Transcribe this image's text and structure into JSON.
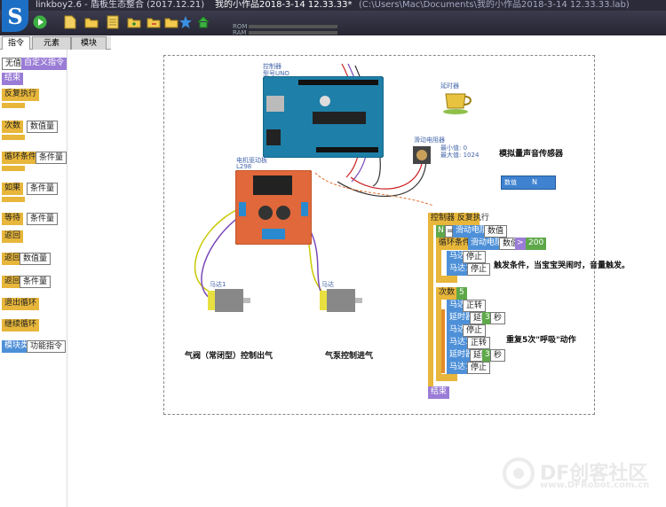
{
  "window": {
    "app_title": "linkboy2.6 - 盾板生态整合 (2017.12.21)",
    "doc_title": "我的小作品2018-3-14 12.33.33*",
    "path": "(C:\\Users\\Mac\\Documents\\我的小作品2018-3-14 12.33.33.lab)"
  },
  "toolbar": {
    "rom_label": "ROM",
    "ram_label": "RAM"
  },
  "logo_text": "S",
  "tabs": [
    "指令",
    "元素",
    "模块"
  ],
  "palette": {
    "none_value": "无值",
    "custom_cmd": "自定义指令",
    "end": "结束",
    "repeat": "反复执行",
    "times": "次数",
    "number": "数值量",
    "loop_cond": "循环条件",
    "condition": "条件量",
    "if": "如果",
    "if_cond": "条件量",
    "wait": "等待",
    "wait_cond": "条件量",
    "return1": "返回",
    "return2": "返回",
    "return2_val": "数值量",
    "return3": "返回",
    "return3_val": "条件量",
    "exit_loop": "退出循环",
    "continue_loop": "继续循环",
    "module_class": "模块类",
    "func_cmd": "功能指令"
  },
  "canvas": {
    "controller_label": "控制器",
    "controller_model": "型号UNO",
    "motor_board_label": "电机驱动板",
    "motor_board_model": "L298",
    "timer_label": "延时器",
    "pot_label": "滑动电阻器",
    "pot_min": "最小值: 0",
    "pot_max": "最大值: 1024",
    "sound_sensor": "模拟量声音传感器",
    "data_label": "数值",
    "data_value": "N",
    "motor1_label": "马达1",
    "motor2_label": "马达",
    "valve_caption": "气阀（常闭型）控制出气",
    "pump_caption": "气泵控制进气",
    "trigger_caption": "触发条件，当宝宝哭闹时，音量触发。",
    "breath_caption": "重复5次\"呼吸\"动作"
  },
  "program": {
    "controller": "控制器",
    "repeat": "反复执行",
    "var_n": "N",
    "eq": "=",
    "pot": "滑动电阻器",
    "value": "数值",
    "loop_cond": "循环条件",
    "pot2": "滑动电阻器",
    "value2": "数值",
    "gt": ">",
    "threshold": "200",
    "motor": "马达",
    "stop": "停止",
    "motor1": "马达1",
    "stop1": "停止",
    "times": "次数",
    "times_val": "5",
    "m_a": "马达",
    "fwd": "正转",
    "timer_a": "延时器",
    "delay_a": "延时",
    "sec_a_val": "3",
    "sec_a": "秒",
    "m_b": "马达",
    "stop_b": "停止",
    "m1_c": "马达1",
    "fwd_c": "正转",
    "timer_d": "延时器",
    "delay_d": "延时",
    "sec_d_val": "3",
    "sec_d": "秒",
    "m1_e": "马达1",
    "stop_e": "停止",
    "end": "结束"
  },
  "watermark": {
    "brand": "DF创客社区",
    "url": "www.DFRobot.com.cn"
  },
  "colors": {
    "block_yellow": "#e7b63a",
    "block_purple": "#9a7cd6",
    "block_blue": "#4e90d8",
    "block_green": "#5ea84a",
    "block_orange": "#e48c2a",
    "arduino_blue": "#1e7fa8",
    "motor_board": "#e0683a"
  },
  "icons": [
    "logo-icon",
    "run-icon",
    "new-file-icon",
    "open-folder-icon",
    "save-icon",
    "folder-add-icon",
    "undo-icon",
    "folder-icon",
    "star-icon",
    "home-icon"
  ]
}
